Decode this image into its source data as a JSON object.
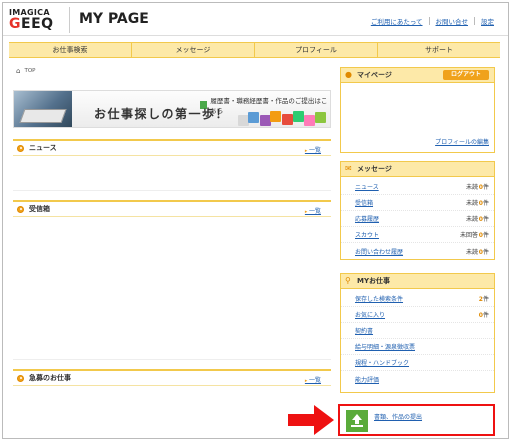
{
  "logo": {
    "line1": "IMAGICA",
    "line2_e": "G",
    "line2": "EEQ"
  },
  "page_title": "MY PAGE",
  "top_links": [
    "ご利用にあたって",
    "お問い合せ",
    "設定"
  ],
  "nav": [
    "お仕事検索",
    "メッセージ",
    "プロフィール",
    "サポート"
  ],
  "breadcrumb": "TOP",
  "banner": {
    "sub": "履歴書・職務経歴書・作品のご提出はこちら",
    "main": "お仕事探しの第一歩！"
  },
  "panels": {
    "news": {
      "title": "ニュース",
      "more": "一覧"
    },
    "inbox": {
      "title": "受信箱",
      "more": "一覧"
    },
    "urgent": {
      "title": "急募のお仕事",
      "more": "一覧"
    }
  },
  "sidebar": {
    "mypage": {
      "title": "マイページ",
      "logout": "ログアウト",
      "profile_edit": "プロフィールの編集"
    },
    "messages": {
      "title": "メッセージ",
      "items": [
        {
          "label": "ニュース",
          "status": "未読",
          "count": "0",
          "unit": "件"
        },
        {
          "label": "受信箱",
          "status": "未読",
          "count": "0",
          "unit": "件"
        },
        {
          "label": "応募履歴",
          "status": "未読",
          "count": "0",
          "unit": "件"
        },
        {
          "label": "スカウト",
          "status": "未回答",
          "count": "0",
          "unit": "件"
        },
        {
          "label": "お問い合わせ履歴",
          "status": "未読",
          "count": "0",
          "unit": "件"
        }
      ]
    },
    "myjobs": {
      "title": "MYお仕事",
      "items": [
        {
          "label": "保存した検索条件",
          "count": "2",
          "unit": "件"
        },
        {
          "label": "お気に入り",
          "count": "0",
          "unit": "件"
        },
        {
          "label": "契約書",
          "count": "",
          "unit": ""
        },
        {
          "label": "給与明細・源泉徴収票",
          "count": "",
          "unit": ""
        },
        {
          "label": "規程・ハンドブック",
          "count": "",
          "unit": ""
        },
        {
          "label": "能力評価",
          "count": "",
          "unit": ""
        }
      ]
    },
    "submit": {
      "label": "書類、作品の提出"
    }
  },
  "colors": {
    "accent": "#f0a21b",
    "nav_bg": "#fde9a8",
    "link": "#2060b0",
    "highlight": "#ee1111"
  }
}
